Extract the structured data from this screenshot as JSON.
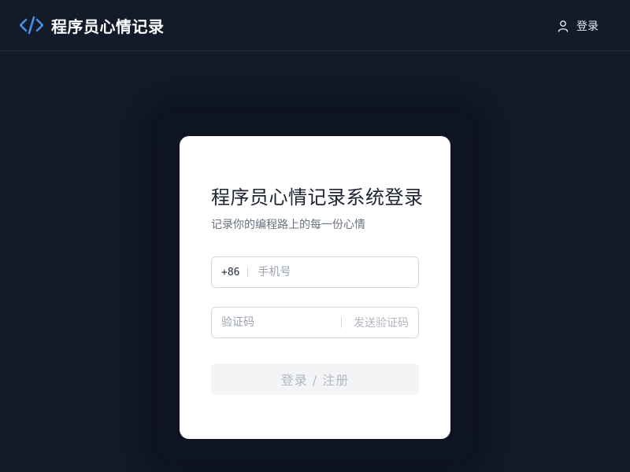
{
  "header": {
    "brand_icon": "code-brackets-icon",
    "app_title": "程序员心情记录",
    "login_icon": "user-icon",
    "login_label": "登录"
  },
  "login_card": {
    "title": "程序员心情记录系统登录",
    "subtitle": "记录你的编程路上的每一份心情",
    "phone": {
      "country_code": "+86",
      "placeholder": "手机号",
      "value": ""
    },
    "verification": {
      "placeholder": "验证码",
      "value": "",
      "send_code_label": "发送验证码"
    },
    "submit_label": "登录 / 注册"
  },
  "colors": {
    "background": "#131a2a",
    "accent": "#4a90e2",
    "card": "#ffffff"
  }
}
